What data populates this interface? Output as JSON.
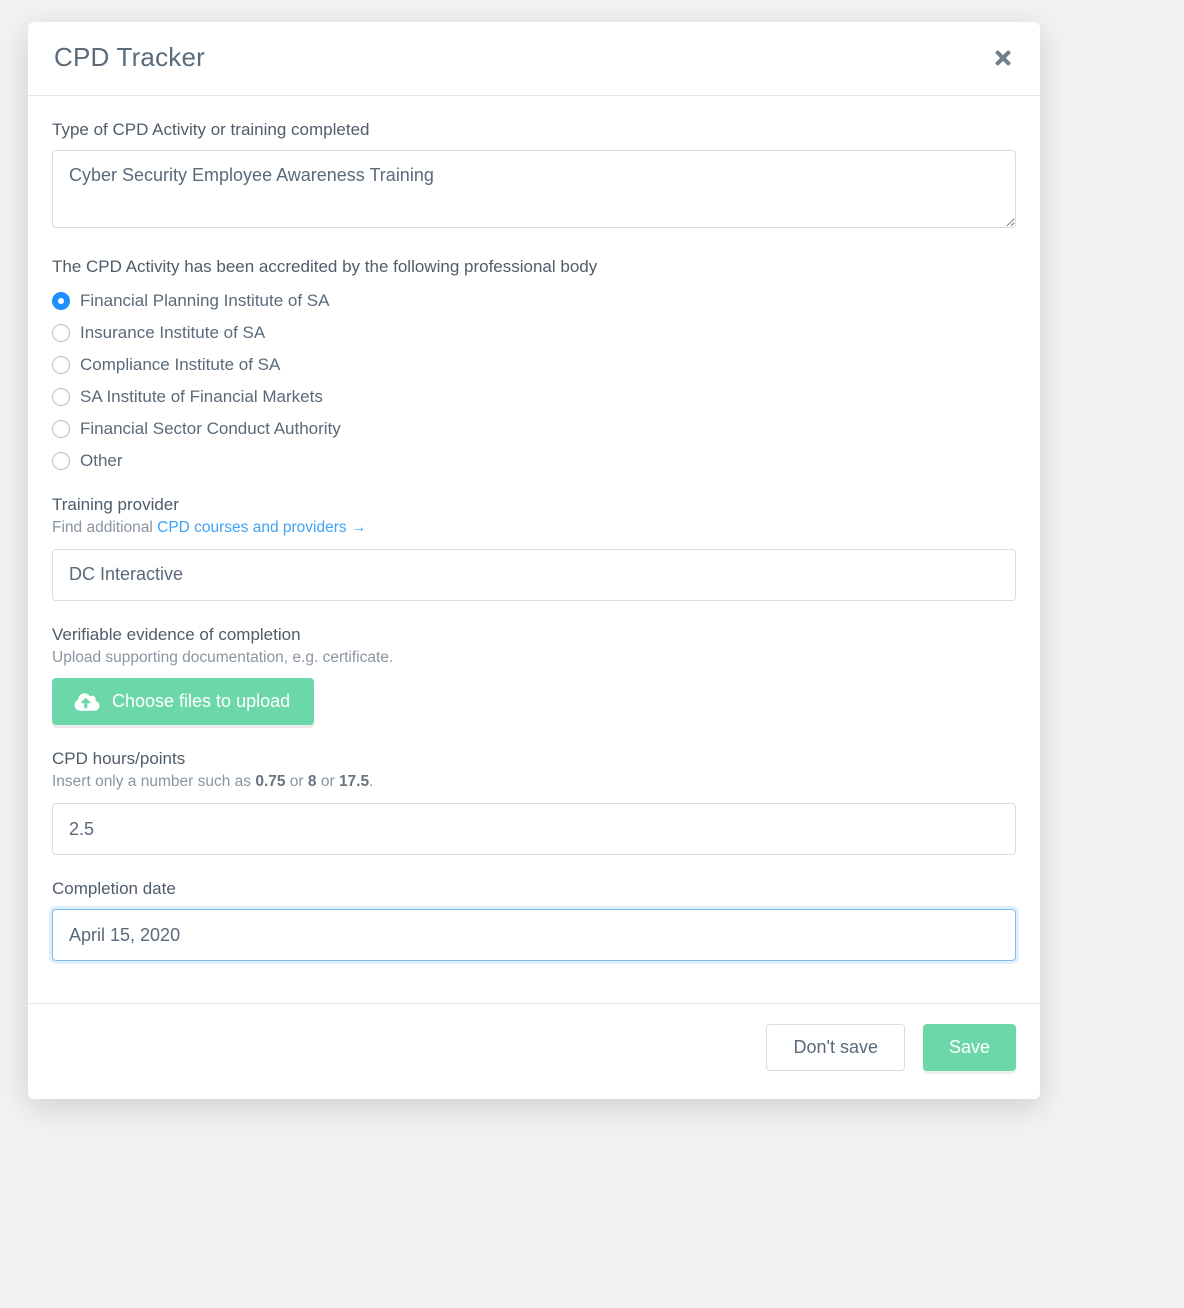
{
  "modal": {
    "title": "CPD Tracker"
  },
  "fields": {
    "activity_type": {
      "label": "Type of CPD Activity or training completed",
      "value": "Cyber Security Employee Awareness Training"
    },
    "accreditation": {
      "label": "The CPD Activity has been accredited by the following professional body",
      "options": [
        {
          "label": "Financial Planning Institute of SA",
          "checked": true
        },
        {
          "label": "Insurance Institute of SA",
          "checked": false
        },
        {
          "label": "Compliance Institute of SA",
          "checked": false
        },
        {
          "label": "SA Institute of Financial Markets",
          "checked": false
        },
        {
          "label": "Financial Sector Conduct Authority",
          "checked": false
        },
        {
          "label": "Other",
          "checked": false
        }
      ]
    },
    "training_provider": {
      "label": "Training provider",
      "hint_prefix": "Find additional ",
      "hint_link": "CPD courses and providers →",
      "value": "DC Interactive"
    },
    "evidence": {
      "label": "Verifiable evidence of completion",
      "hint": "Upload supporting documentation, e.g. certificate.",
      "button": "Choose files to upload"
    },
    "hours": {
      "label": "CPD hours/points",
      "hint_prefix": "Insert only a number such as ",
      "hint_ex1": "0.75",
      "hint_or1": " or ",
      "hint_ex2": "8",
      "hint_or2": " or ",
      "hint_ex3": "17.5",
      "hint_suffix": ".",
      "value": "2.5"
    },
    "completion_date": {
      "label": "Completion date",
      "value": "April 15, 2020"
    }
  },
  "footer": {
    "cancel": "Don't save",
    "save": "Save"
  }
}
